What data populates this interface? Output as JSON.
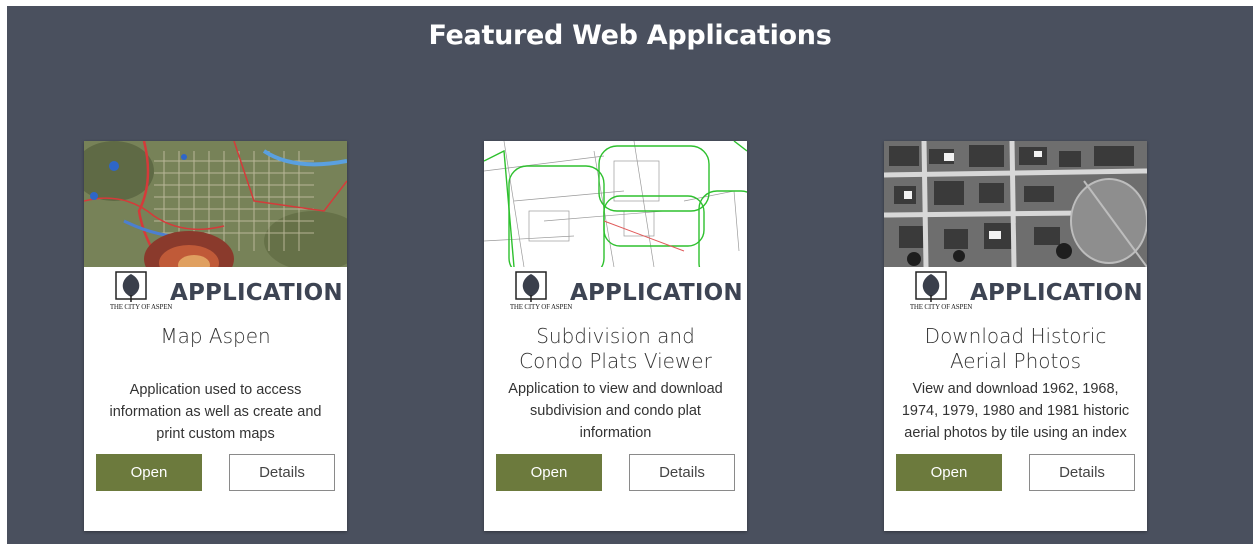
{
  "page": {
    "title": "Featured Web Applications"
  },
  "cards": [
    {
      "brand_label": "APPLICATION",
      "logo_text": "THE CITY OF ASPEN",
      "title_lines": [
        "Map Aspen"
      ],
      "description_lines": [
        "Application used to access",
        "information as well as create and",
        "print custom maps"
      ],
      "open_label": "Open",
      "details_label": "Details"
    },
    {
      "brand_label": "APPLICATION",
      "logo_text": "THE CITY OF ASPEN",
      "title_lines": [
        "Subdivision and",
        "Condo Plats Viewer"
      ],
      "description_lines": [
        "Application to view and download",
        "subdivision and condo plat",
        "information"
      ],
      "open_label": "Open",
      "details_label": "Details"
    },
    {
      "brand_label": "APPLICATION",
      "logo_text": "THE CITY OF ASPEN",
      "title_lines": [
        "Download Historic",
        "Aerial Photos"
      ],
      "description_lines": [
        "View and download 1962, 1968,",
        "1974, 1979, 1980 and 1981 historic",
        "aerial photos by tile using an index"
      ],
      "open_label": "Open",
      "details_label": "Details"
    }
  ],
  "colors": {
    "background": "#4a505e",
    "open_button": "#6c7a3d",
    "brand_text": "#3d4453"
  }
}
